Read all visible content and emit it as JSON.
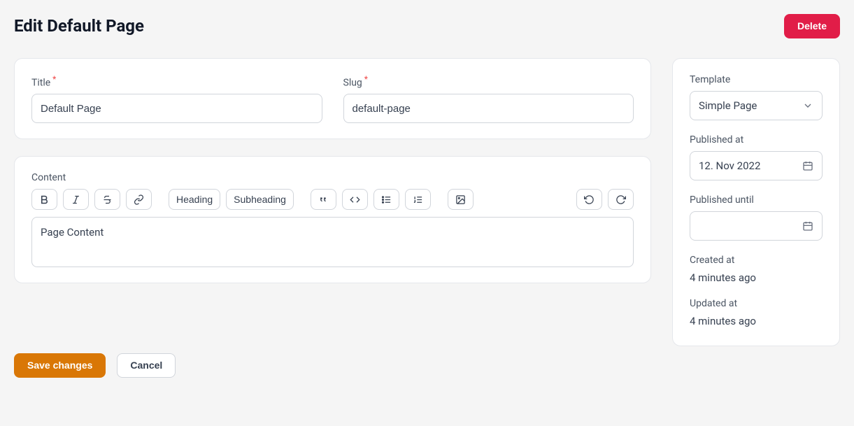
{
  "header": {
    "title": "Edit Default Page",
    "delete_label": "Delete"
  },
  "form": {
    "title_label": "Title",
    "title_value": "Default Page",
    "slug_label": "Slug",
    "slug_value": "default-page",
    "content_label": "Content",
    "content_value": "Page Content"
  },
  "toolbar": {
    "heading_label": "Heading",
    "subheading_label": "Subheading"
  },
  "sidebar": {
    "template_label": "Template",
    "template_value": "Simple Page",
    "published_at_label": "Published at",
    "published_at_value": "12. Nov 2022",
    "published_until_label": "Published until",
    "published_until_value": "",
    "created_at_label": "Created at",
    "created_at_value": "4 minutes ago",
    "updated_at_label": "Updated at",
    "updated_at_value": "4 minutes ago"
  },
  "footer": {
    "save_label": "Save changes",
    "cancel_label": "Cancel"
  }
}
